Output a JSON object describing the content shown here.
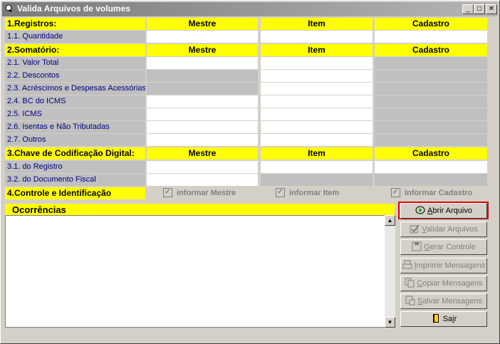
{
  "window": {
    "title": "Valida Arquivos de volumes",
    "controls": [
      "_",
      "□",
      "✕"
    ]
  },
  "sections": {
    "registros": {
      "title": "1.Registros:",
      "cols": [
        "Mestre",
        "Item",
        "Cadastro"
      ],
      "rows": [
        {
          "label": "1.1. Quantidade"
        }
      ]
    },
    "somatorio": {
      "title": "2.Somatório:",
      "cols": [
        "Mestre",
        "Item",
        "Cadastro"
      ],
      "rows": [
        {
          "label": "2.1. Valor Total"
        },
        {
          "label": "2.2. Descontos"
        },
        {
          "label": "2.3. Acréscimos e Despesas Acessórias"
        },
        {
          "label": "2.4. BC do ICMS"
        },
        {
          "label": "2.5. ICMS"
        },
        {
          "label": "2.6. Isentas e Não Tributadas"
        },
        {
          "label": "2.7. Outros"
        }
      ]
    },
    "chave": {
      "title": "3.Chave de Codificação Digital:",
      "cols": [
        "Mestre",
        "Item",
        "Cadastro"
      ],
      "rows": [
        {
          "label": "3.1. do Registro"
        },
        {
          "label": "3.2. do Documento Fiscal"
        }
      ]
    },
    "controle": {
      "title": "4.Controle e Identificação",
      "checks": [
        {
          "label": "informar Mestre",
          "checked": true
        },
        {
          "label": "informar Item",
          "checked": true
        },
        {
          "label": "informar Cadastro",
          "checked": true
        }
      ]
    }
  },
  "ocorrencias": {
    "title": "Ocorrências",
    "text": ""
  },
  "buttons": {
    "abrir": {
      "pre": "",
      "u": "A",
      "post": "brir Arquivo"
    },
    "validar": {
      "pre": "",
      "u": "V",
      "post": "alidar Arquivos"
    },
    "gerar": {
      "pre": "",
      "u": "G",
      "post": "erar Controle"
    },
    "imprimir": {
      "pre": "",
      "u": "I",
      "post": "mprimir Mensagens"
    },
    "copiar": {
      "pre": "",
      "u": "C",
      "post": "opiar Mensagens"
    },
    "salvar": {
      "pre": "",
      "u": "S",
      "post": "alvar Mensagens"
    },
    "sair": {
      "pre": "Sa",
      "u": "i",
      "post": "r"
    }
  },
  "colors": {
    "header": "#ffff00",
    "label_bg": "#c0c0c0",
    "focus": "#e00000"
  }
}
